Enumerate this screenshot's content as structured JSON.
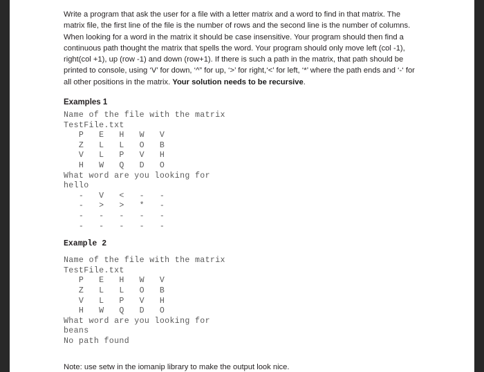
{
  "document": {
    "prompt": {
      "text_before_bold": "Write a program that ask the user for a file with a letter matrix and a word to find in that matrix. The matrix file, the first line of the file is the number of rows and the second line is the number of columns. When looking for a word in the matrix it should be case insensitive. Your program should then find a continuous path thought the matrix that spells the word. Your program should only move left (col -1), right(col +1), up (row -1) and down (row+1).  If there is such a path in the matrix, that path should be printed to console, using ‘V’ for down, ‘^” for up, ‘>’ for right,‘<’ for left, ‘*’ where the path ends and ‘-‘ for all other positions in the matrix. ",
      "bold_text": "Your solution needs to be recursive",
      "text_after_bold": "."
    },
    "example_one": {
      "heading": "Examples 1",
      "console": "Name of the file with the matrix\nTestFile.txt\n   P   E   H   W   V\n   Z   L   L   O   B\n   V   L   P   V   H\n   H   W   Q   D   O\nWhat word are you looking for\nhello\n   -   V   <   -   -\n   -   >   >   *   -\n   -   -   -   -   -\n   -   -   -   -   -"
    },
    "example_two": {
      "heading": "Example 2",
      "console": "Name of the file with the matrix\nTestFile.txt\n   P   E   H   W   V\n   Z   L   L   O   B\n   V   L   P   V   H\n   H   W   Q   D   O\nWhat word are you looking for\nbeans\nNo path found"
    },
    "note": "Note: use setw in the iomanip library to make the output look nice.",
    "colors": {
      "gutter": "#282828",
      "body_text": "#231f20",
      "console_text": "#595959",
      "page_background": "#ffffff"
    }
  }
}
